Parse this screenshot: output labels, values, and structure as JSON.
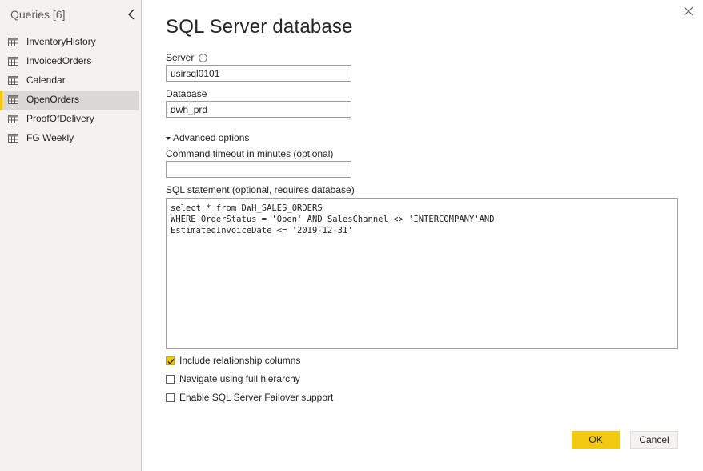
{
  "sidebar": {
    "header": "Queries [6]",
    "collapse_icon": "chevron-left-icon",
    "items": [
      {
        "label": "InventoryHistory",
        "icon": "table-icon",
        "selected": false
      },
      {
        "label": "InvoicedOrders",
        "icon": "table-icon",
        "selected": false
      },
      {
        "label": "Calendar",
        "icon": "table-icon",
        "selected": false
      },
      {
        "label": "OpenOrders",
        "icon": "table-icon",
        "selected": true
      },
      {
        "label": "ProofOfDelivery",
        "icon": "table-icon",
        "selected": false
      },
      {
        "label": "FG Weekly",
        "icon": "table-icon",
        "selected": false
      }
    ]
  },
  "dialog": {
    "title": "SQL Server database",
    "close_icon": "close-icon",
    "server": {
      "label": "Server",
      "info_icon": "info-icon",
      "value": "usirsql0101"
    },
    "database": {
      "label": "Database",
      "value": "dwh_prd"
    },
    "advanced": {
      "toggle_label": "Advanced options",
      "expanded": true,
      "timeout": {
        "label": "Command timeout in minutes (optional)",
        "value": ""
      },
      "sql": {
        "label": "SQL statement (optional, requires database)",
        "value": "select * from DWH_SALES_ORDERS\nWHERE OrderStatus = 'Open' AND SalesChannel <> 'INTERCOMPANY'AND\nEstimatedInvoiceDate <= '2019-12-31'"
      },
      "options": [
        {
          "label": "Include relationship columns",
          "checked": true
        },
        {
          "label": "Navigate using full hierarchy",
          "checked": false
        },
        {
          "label": "Enable SQL Server Failover support",
          "checked": false
        }
      ]
    },
    "buttons": {
      "ok_label": "OK",
      "cancel_label": "Cancel"
    }
  },
  "colors": {
    "accent": "#f2c811",
    "sidebar_bg": "#f3f2f1",
    "selected_bg": "#d9d8d7",
    "text": "#252423"
  }
}
